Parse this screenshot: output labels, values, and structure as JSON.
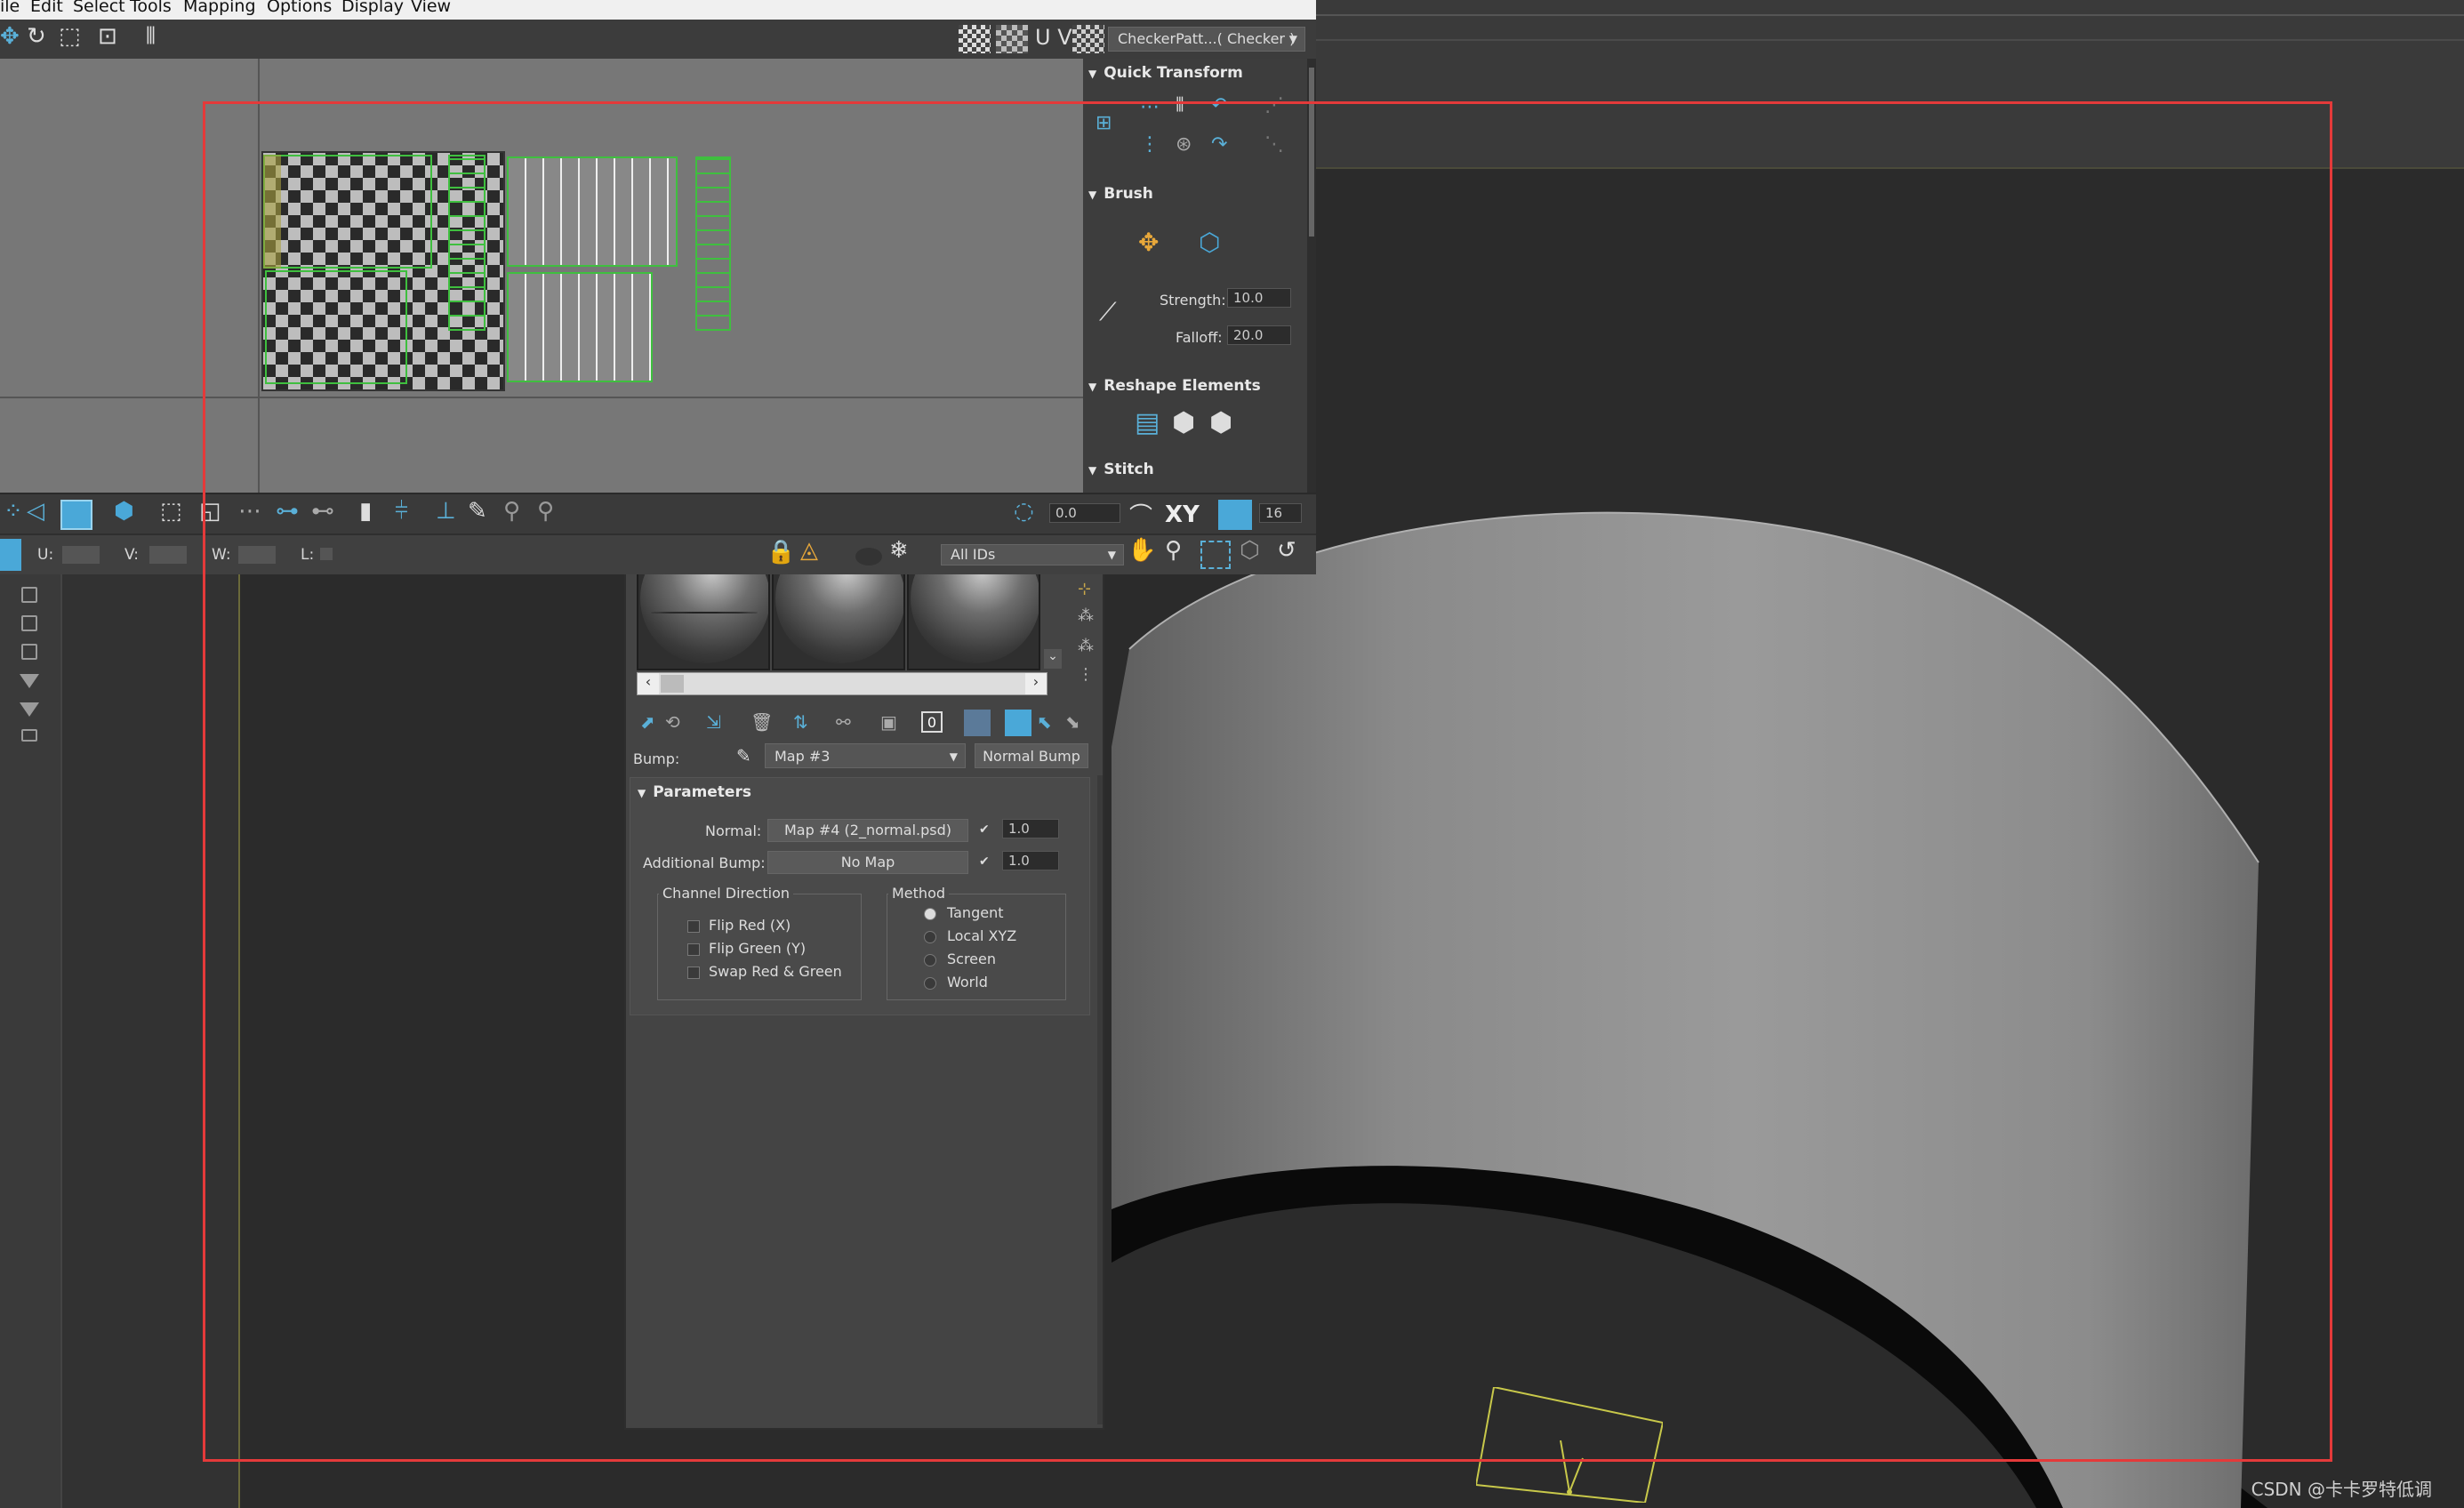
{
  "uv_editor": {
    "menu": [
      "ile",
      "Edit",
      "Select",
      "Tools",
      "Mapping",
      "Options",
      "Display",
      "View"
    ],
    "uv_label": "U V",
    "checker_combo": "CheckerPatt...( Checker )",
    "rollouts": {
      "quick_transform": "Quick Transform",
      "brush": "Brush",
      "strength_label": "Strength:",
      "strength_value": "10.0",
      "falloff_label": "Falloff:",
      "falloff_value": "20.0",
      "reshape": "Reshape Elements",
      "stitch": "Stitch"
    },
    "bottom_toolbar": {
      "angle_value": "0.0",
      "xy_label": "XY",
      "grid_value": "16"
    },
    "status": {
      "u_label": "U:",
      "v_label": "V:",
      "w_label": "W:",
      "l_label": "L:",
      "ids_combo": "All IDs"
    }
  },
  "material_editor": {
    "bump_label": "Bump:",
    "map_combo": "Map #3",
    "type_button": "Normal Bump",
    "parameters_title": "Parameters",
    "normal_label": "Normal:",
    "normal_map": "Map #4 (2_normal.psd)",
    "normal_value": "1.0",
    "additional_bump_label": "Additional Bump:",
    "additional_bump_map": "No Map",
    "additional_bump_value": "1.0",
    "channel_direction_title": "Channel Direction",
    "channel_options": [
      "Flip Red (X)",
      "Flip Green (Y)",
      "Swap Red & Green"
    ],
    "method_title": "Method",
    "method_options": [
      "Tangent",
      "Local XYZ",
      "Screen",
      "World"
    ],
    "method_selected": "Tangent"
  },
  "watermark": "CSDN @卡卡罗特低调",
  "colors": {
    "safe_frame": "#e43a3a",
    "uv_shell": "#3fbf3f",
    "accent_blue": "#4aa8d8"
  }
}
